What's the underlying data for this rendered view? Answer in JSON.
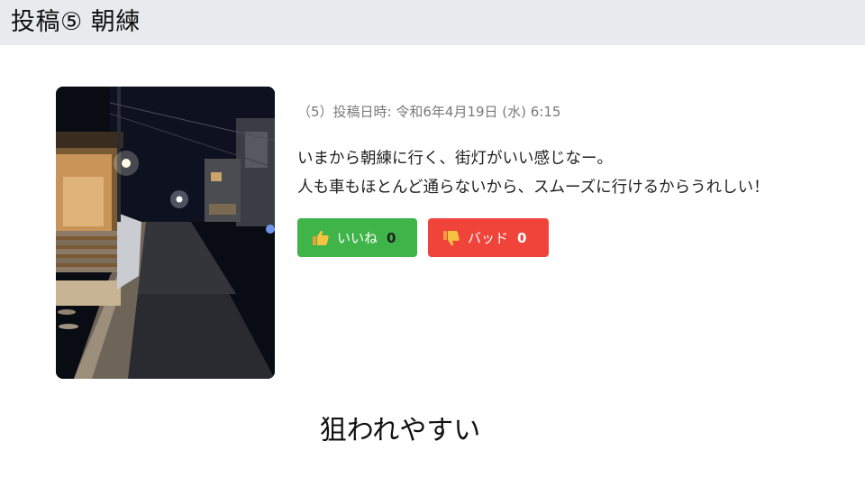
{
  "header": {
    "title": "投稿⑤ 朝練"
  },
  "post": {
    "meta": "（5）投稿日時: 令和6年4月19日 (水) 6:15",
    "lines": [
      "いまから朝練に行く、街灯がいい感じなー。",
      "人も車もほとんど通らないから、スムーズに行けるからうれしい！"
    ],
    "like": {
      "label": "いいね",
      "count": "0",
      "icon": "thumbs-up-icon",
      "color": "#3fb449"
    },
    "bad": {
      "label": "バッド",
      "count": "0",
      "icon": "thumbs-down-icon",
      "color": "#f0433a"
    }
  },
  "caption": "狙われやすい"
}
